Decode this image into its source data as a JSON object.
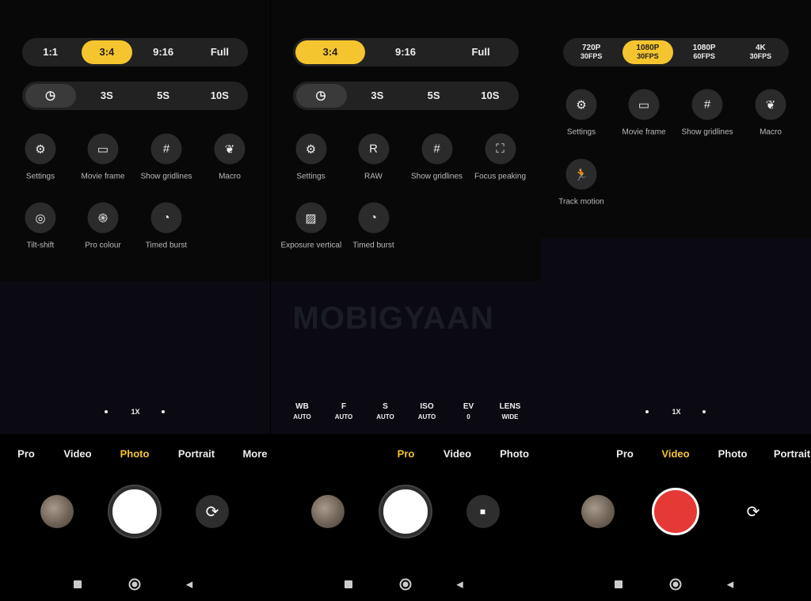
{
  "colors": {
    "accent": "#f5c52f",
    "record": "#e53935",
    "panel": "#222222"
  },
  "watermark": "MOBIGYAAN",
  "panels": [
    {
      "ratio_options": [
        {
          "label": "1:1"
        },
        {
          "label": "3:4",
          "selected": true
        },
        {
          "label": "9:16"
        },
        {
          "label": "Full"
        }
      ],
      "timer_options": [
        {
          "icon": "timer-off-icon",
          "selected": true
        },
        {
          "label": "3S"
        },
        {
          "label": "5S"
        },
        {
          "label": "10S"
        }
      ],
      "tools": [
        {
          "label": "Settings",
          "icon": "settings-icon"
        },
        {
          "label": "Movie frame",
          "icon": "movie-frame-icon"
        },
        {
          "label": "Show gridlines",
          "icon": "grid-icon"
        },
        {
          "label": "Macro",
          "icon": "macro-icon"
        },
        {
          "label": "Tilt-shift",
          "icon": "tilt-shift-icon"
        },
        {
          "label": "Pro colour",
          "icon": "pro-colour-icon"
        },
        {
          "label": "Timed burst",
          "icon": "timed-burst-icon"
        }
      ],
      "zoom": "1X",
      "modes": [
        {
          "label": "Pro"
        },
        {
          "label": "Video"
        },
        {
          "label": "Photo",
          "active": true
        },
        {
          "label": "Portrait"
        },
        {
          "label": "More"
        }
      ],
      "right_button": "switch-camera-icon",
      "shutter": "photo"
    },
    {
      "ratio_options": [
        {
          "label": "3:4",
          "selected": true
        },
        {
          "label": "9:16"
        },
        {
          "label": "Full"
        }
      ],
      "timer_options": [
        {
          "icon": "timer-off-icon",
          "selected": true
        },
        {
          "label": "3S"
        },
        {
          "label": "5S"
        },
        {
          "label": "10S"
        }
      ],
      "tools": [
        {
          "label": "Settings",
          "icon": "settings-icon"
        },
        {
          "label": "RAW",
          "icon": "raw-icon"
        },
        {
          "label": "Show gridlines",
          "icon": "grid-icon"
        },
        {
          "label": "Focus peaking",
          "icon": "focus-peaking-icon"
        },
        {
          "label": "Exposure vertical",
          "icon": "exposure-icon"
        },
        {
          "label": "Timed burst",
          "icon": "timed-burst-icon"
        }
      ],
      "pro_params": [
        {
          "name": "WB",
          "value": "AUTO"
        },
        {
          "name": "F",
          "value": "AUTO"
        },
        {
          "name": "S",
          "value": "AUTO"
        },
        {
          "name": "ISO",
          "value": "AUTO"
        },
        {
          "name": "EV",
          "value": "0"
        },
        {
          "name": "LENS",
          "value": "WIDE"
        }
      ],
      "modes": [
        {
          "label": "Pro",
          "active": true
        },
        {
          "label": "Video"
        },
        {
          "label": "Photo"
        }
      ],
      "right_button": "video-camera-icon",
      "shutter": "photo"
    },
    {
      "resolution_options": [
        {
          "label": "720P",
          "sub": "30FPS"
        },
        {
          "label": "1080P",
          "sub": "30FPS",
          "selected": true
        },
        {
          "label": "1080P",
          "sub": "60FPS"
        },
        {
          "label": "4K",
          "sub": "30FPS"
        }
      ],
      "tools": [
        {
          "label": "Settings",
          "icon": "settings-icon"
        },
        {
          "label": "Movie frame",
          "icon": "movie-frame-icon"
        },
        {
          "label": "Show gridlines",
          "icon": "grid-icon"
        },
        {
          "label": "Macro",
          "icon": "macro-icon"
        },
        {
          "label": "Track motion",
          "icon": "running-icon"
        }
      ],
      "zoom": "1X",
      "modes": [
        {
          "label": "Pro"
        },
        {
          "label": "Video",
          "active": true
        },
        {
          "label": "Photo"
        },
        {
          "label": "Portrait"
        }
      ],
      "right_button": "switch-camera-icon",
      "shutter": "record"
    }
  ]
}
